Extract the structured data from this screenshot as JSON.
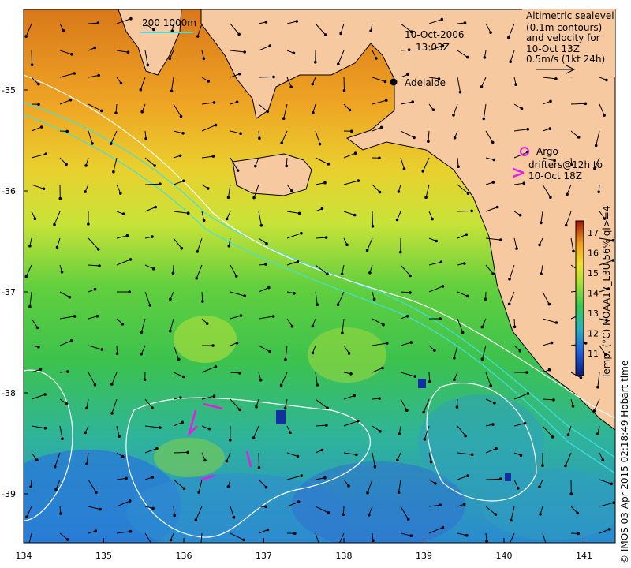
{
  "timestamp": {
    "date": "10-Oct-2006",
    "time": "13:03Z"
  },
  "scale_label": "200  1000m",
  "city": {
    "name": "Adelaide"
  },
  "sealevel_note": {
    "lines": [
      "Altimetric sealevel",
      "(0.1m contours)",
      "and velocity for",
      "10-Oct 13Z",
      "0.5m/s (1kt 24h)"
    ]
  },
  "argo_note": {
    "symbol_circle": "o",
    "symbol_arrow": ">",
    "lines": [
      "Argo",
      "drifters@12h to",
      "10-Oct 18Z"
    ]
  },
  "colorbar": {
    "label": "Temp. (°C) NOAA17_L3U 56% ql>=4",
    "ticks": [
      "17",
      "16",
      "15",
      "14",
      "13",
      "12",
      "11"
    ]
  },
  "credit": "© IMOS 03-Apr-2015 02:18:49 Hobart time",
  "axes": {
    "x_ticks": [
      "134",
      "135",
      "136",
      "137",
      "138",
      "139",
      "140",
      "141"
    ],
    "y_ticks": [
      "-35",
      "-36",
      "-37",
      "-38",
      "-39"
    ]
  },
  "colors": {
    "land": "#f7c9a0",
    "warm": "#e88a1e",
    "yellow": "#dde63a",
    "green": "#48c84a",
    "teal": "#3ab8a0",
    "blue": "#2a7ce0",
    "contour": "#ffffff",
    "isobath": "#40e0e0",
    "argo": "#e020e0"
  }
}
